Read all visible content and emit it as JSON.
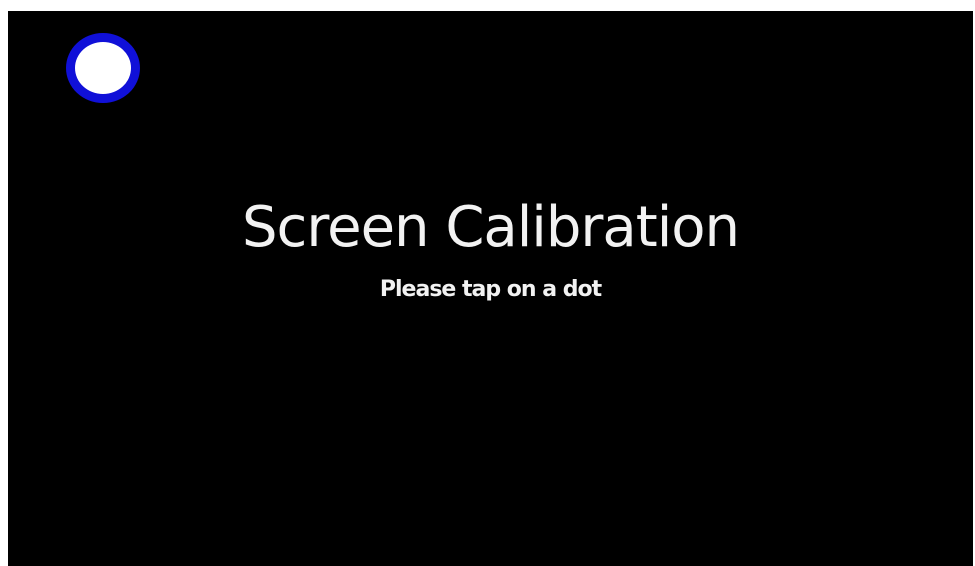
{
  "screen": {
    "title": "Screen Calibration",
    "subtitle": "Please tap on a dot",
    "background_color": "#000000",
    "text_color": "#f2f2f2"
  },
  "calibration_dot": {
    "icon": "circle-target-icon",
    "ring_color": "#1010d8",
    "fill_color": "#ffffff"
  }
}
